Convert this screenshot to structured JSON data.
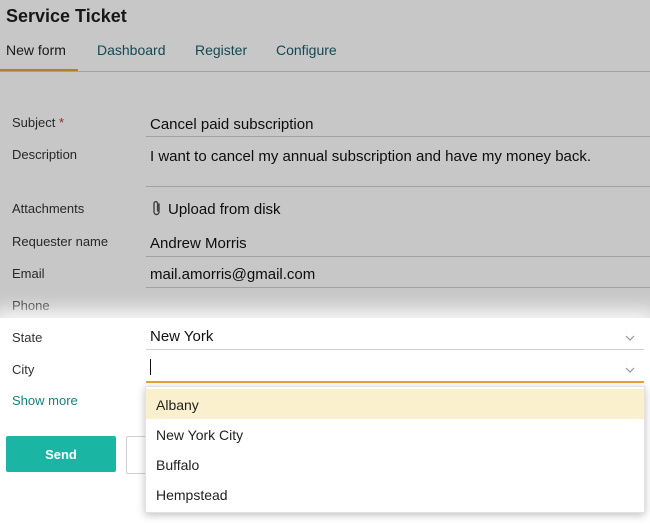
{
  "app": {
    "title": "Service Ticket"
  },
  "tabs": [
    {
      "label": "New form",
      "active": true
    },
    {
      "label": "Dashboard",
      "active": false
    },
    {
      "label": "Register",
      "active": false
    },
    {
      "label": "Configure",
      "active": false
    }
  ],
  "form": {
    "subject": {
      "label": "Subject",
      "required_mark": "*",
      "value": "Cancel paid subscription"
    },
    "description": {
      "label": "Description",
      "value": "I want to cancel my annual subscription and have my money back."
    },
    "attachments": {
      "label": "Attachments",
      "action": "Upload from disk",
      "icon": "paperclip-icon"
    },
    "requester_name": {
      "label": "Requester name",
      "value": "Andrew Morris"
    },
    "email": {
      "label": "Email",
      "value": "mail.amorris@gmail.com"
    },
    "phone": {
      "label": "Phone",
      "value": ""
    },
    "state": {
      "label": "State",
      "value": "New York"
    },
    "city": {
      "label": "City",
      "value": "",
      "options": [
        "Albany",
        "New York City",
        "Buffalo",
        "Hempstead"
      ],
      "highlighted_option": "Albany"
    }
  },
  "show_more": "Show more",
  "actions": {
    "send_label": "Send"
  },
  "colors": {
    "accent": "#e3a436",
    "primary": "#1bb5a4",
    "link": "#15837a",
    "highlight": "#fbf0cd"
  }
}
